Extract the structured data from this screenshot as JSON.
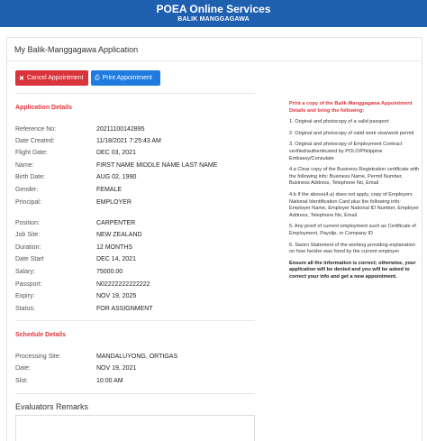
{
  "header": {
    "title": "POEA Online Services",
    "subtitle": "BALIK MANGGAGAWA"
  },
  "page": {
    "title": "My Balik-Manggagawa Application"
  },
  "buttons": {
    "cancel_label": "Cancel Appointment",
    "cancel_icon": "x-square-icon",
    "print_label": "Print Appointment",
    "print_icon": "printer-icon"
  },
  "application": {
    "title": "Application Details",
    "rows": [
      {
        "label": "Reference No:",
        "value": "20211100142895"
      },
      {
        "label": "Date Created:",
        "value": "11/18/2021 7:25:43 AM"
      },
      {
        "label": "Flight Date:",
        "value": "DEC 03, 2021"
      },
      {
        "label": "Name:",
        "value": "FIRST NAME MIDDLE NAME LAST NAME"
      },
      {
        "label": "Birth Date:",
        "value": "AUG 02, 1990"
      },
      {
        "label": "Gender:",
        "value": "FEMALE"
      },
      {
        "label": "Principal:",
        "value": "EMPLOYER"
      },
      {
        "label": "Position:",
        "value": "CARPENTER"
      },
      {
        "label": "Job Site:",
        "value": "NEW ZEALAND"
      },
      {
        "label": "Duration:",
        "value": "12 MONTHS"
      },
      {
        "label": "Date Start",
        "value": "DEC 14, 2021"
      },
      {
        "label": "Salary:",
        "value": "75000.00"
      },
      {
        "label": "Passport:",
        "value": "N02222222222222"
      },
      {
        "label": "Expiry:",
        "value": "NOV 19, 2025"
      },
      {
        "label": "Status:",
        "value": "FOR ASSIGNMENT"
      }
    ]
  },
  "schedule": {
    "title": "Schedule Details",
    "rows": [
      {
        "label": "Processing Site:",
        "value": "MANDALUYONG, ORTIGAS"
      },
      {
        "label": "Date:",
        "value": "NOV 19, 2021"
      },
      {
        "label": "Slot:",
        "value": "10:00 AM"
      }
    ]
  },
  "remarks": {
    "title": "Evaluators Remarks"
  },
  "instructions": {
    "intro": "Print a copy of the Balik-Manggagawa Appointment Details and bring the following:",
    "items": [
      "1. Original and photocopy of a valid passport",
      "2. Original and photocopy of valid work visa/work permit",
      "3. Original and photocopy of Employment Contract verified/authenticated by POLO/Philippine Embassy/Consulate",
      "4.a Clear copy of the Business Registration certificate with the following info: Business Name, Permit Number, Business Address, Telephone No, Email",
      "4.b If the above(4.a) does not apply, copy of Employers National Identification Card plus the following info: Employer Name, Employer National ID Number, Employer Address, Telephone No, Email",
      "5. Any proof of current employment such as Certificate of Employment, Payslip, or Company ID",
      "6. Sworn Statement of the working providing explanation on how he/she was hired by the current employer"
    ],
    "outro": "Ensure all the information is correct; otherwise, your application will be denied and you will be asked to correct your info and get a new appointment."
  },
  "colors": {
    "header_bg": "#1f5fb0",
    "danger": "#d9343b",
    "primary": "#1f7be0",
    "accent_text": "#e2343c"
  }
}
